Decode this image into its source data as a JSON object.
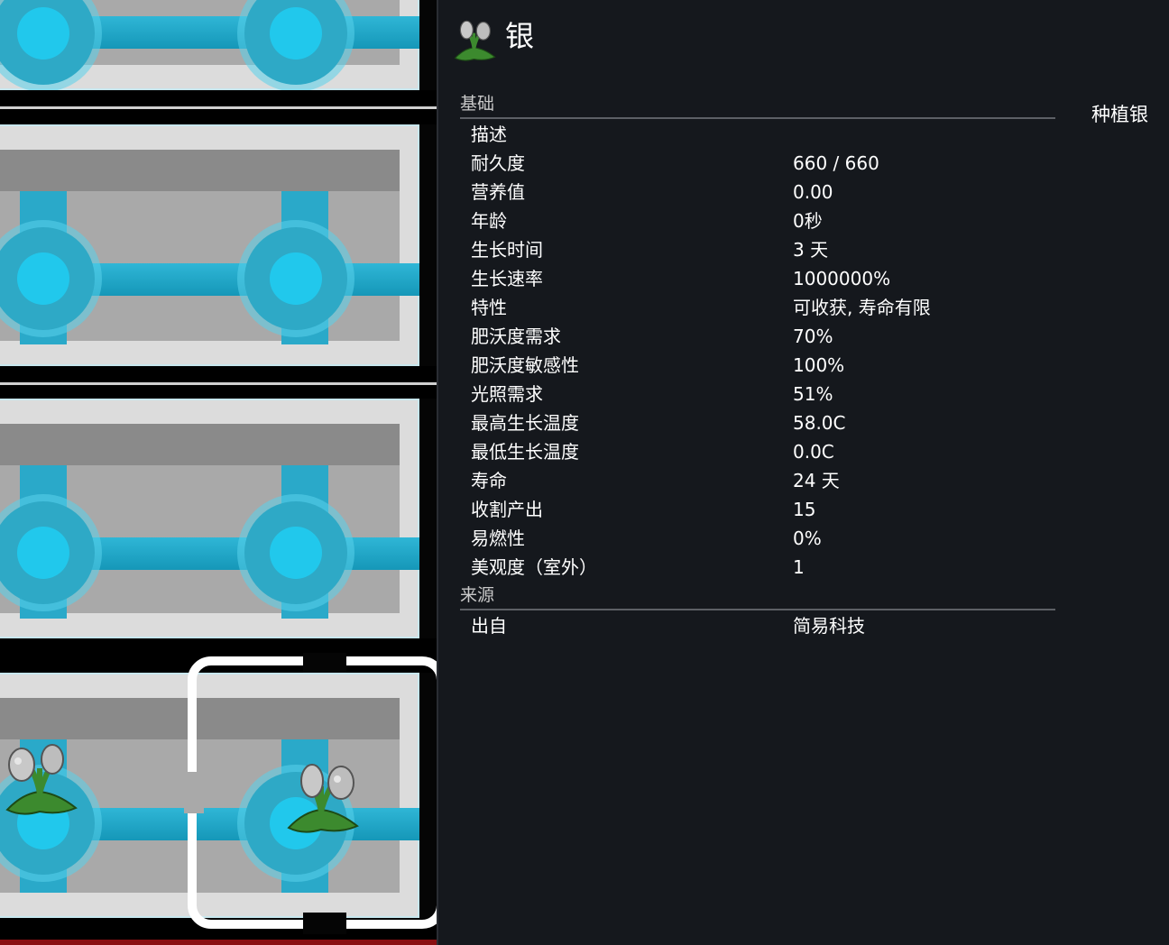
{
  "header": {
    "title": "银",
    "def_name": "种植银",
    "icon": "silver-plant-icon"
  },
  "sections": [
    {
      "heading": "基础",
      "rows": [
        {
          "label": "描述",
          "value": ""
        },
        {
          "label": "耐久度",
          "value": "660 / 660"
        },
        {
          "label": "营养值",
          "value": "0.00"
        },
        {
          "label": "年龄",
          "value": "0秒"
        },
        {
          "label": "生长时间",
          "value": "3 天"
        },
        {
          "label": "生长速率",
          "value": "1000000%"
        },
        {
          "label": "特性",
          "value": "可收获, 寿命有限"
        },
        {
          "label": "肥沃度需求",
          "value": "70%"
        },
        {
          "label": "肥沃度敏感性",
          "value": "100%"
        },
        {
          "label": "光照需求",
          "value": "51%"
        },
        {
          "label": "最高生长温度",
          "value": "58.0C"
        },
        {
          "label": "最低生长温度",
          "value": "0.0C"
        },
        {
          "label": "寿命",
          "value": "24 天"
        },
        {
          "label": "收割产出",
          "value": "15"
        },
        {
          "label": "易燃性",
          "value": "0%"
        },
        {
          "label": "美观度（室外）",
          "value": "1"
        }
      ]
    },
    {
      "heading": "来源",
      "rows": [
        {
          "label": "出自",
          "value": "简易科技"
        }
      ]
    }
  ],
  "colors": {
    "panel_bg": "#15181d",
    "pipe_cyan": "#21c8ec",
    "plant_green": "#3c8a2e",
    "silver_pod": "#c8c8c8"
  }
}
